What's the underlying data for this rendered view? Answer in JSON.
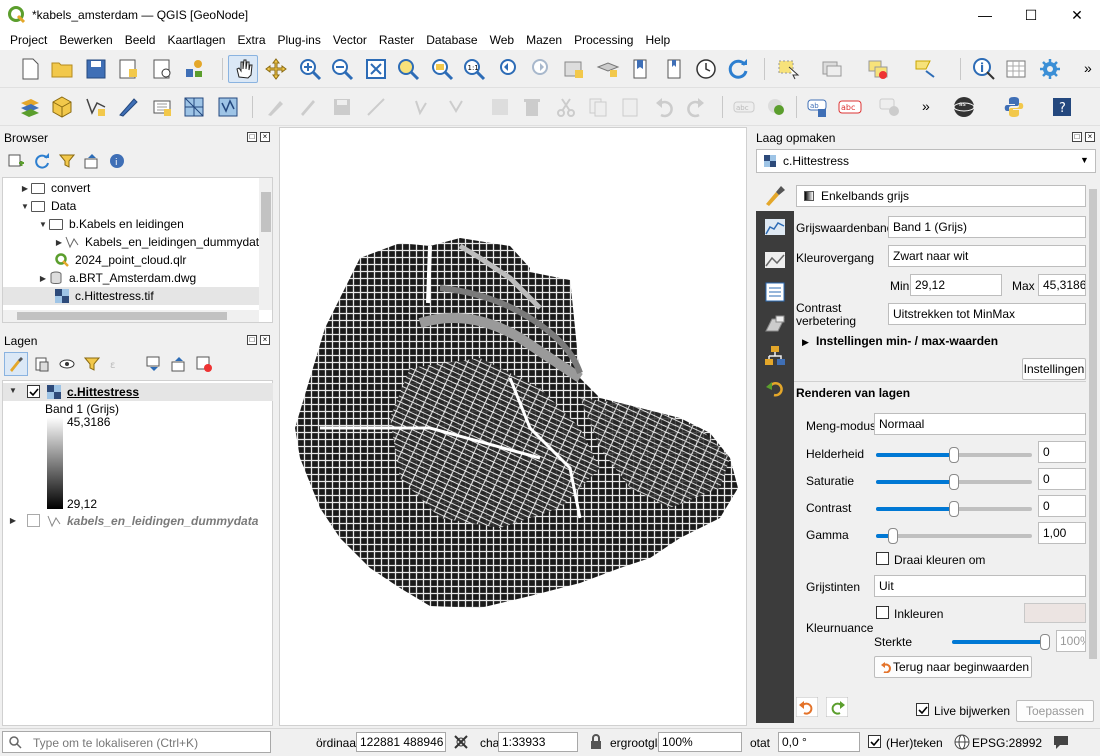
{
  "window": {
    "title": "*kabels_amsterdam — QGIS [GeoNode]"
  },
  "menu": [
    "Project",
    "Bewerken",
    "Beeld",
    "Kaartlagen",
    "Extra",
    "Plug-ins",
    "Vector",
    "Raster",
    "Database",
    "Web",
    "Mazen",
    "Processing",
    "Help"
  ],
  "toolbar_icons_row1": [
    "new-project-icon",
    "open-project-icon",
    "save-project-icon",
    "new-print-layout-icon",
    "layout-manager-icon",
    "style-manager-icon",
    "pan-icon",
    "pan-to-selection-icon",
    "zoom-in-icon",
    "zoom-out-icon",
    "zoom-full-icon",
    "zoom-to-selection-icon",
    "zoom-to-layer-icon",
    "zoom-native-icon",
    "zoom-last-icon",
    "zoom-next-icon",
    "new-bookmark-icon",
    "show-bookmarks-icon",
    "temporal-controller-icon",
    "refresh-icon",
    "select-features-icon",
    "deselect-icon",
    "select-by-expression-icon",
    "identify-icon",
    "attribute-table-icon",
    "settings-icon"
  ],
  "toolbar_icons_row2": [
    "data-source-manager-icon",
    "new-geopackage-icon",
    "new-shapefile-icon",
    "digitize-icon",
    "virtual-layer-icon",
    "new-mesh-icon",
    "toggle-editing-icon",
    "save-edits-icon",
    "add-feature-icon",
    "vertex-tool-icon",
    "delete-icon",
    "cut-icon",
    "copy-icon",
    "paste-icon",
    "undo-icon",
    "redo-icon",
    "label-icon",
    "pin-labels-icon",
    "show-labels-icon",
    "python-icon",
    "help-icon"
  ],
  "browser": {
    "title": "Browser",
    "items": [
      {
        "label": "convert",
        "type": "folder"
      },
      {
        "label": "Data",
        "type": "folder"
      },
      {
        "label": "b.Kabels en leidingen",
        "type": "folder"
      },
      {
        "label": "Kabels_en_leidingen_dummydata.s",
        "type": "vector"
      },
      {
        "label": "2024_point_cloud.qlr",
        "type": "qgis"
      },
      {
        "label": "a.BRT_Amsterdam.dwg",
        "type": "db"
      },
      {
        "label": "c.Hittestress.tif",
        "type": "raster"
      }
    ]
  },
  "layers": {
    "title": "Lagen",
    "layer1": {
      "name": "c.Hittestress",
      "band": "Band 1 (Grijs)",
      "max": "45,3186",
      "min": "29,12"
    },
    "layer2": {
      "name": "kabels_en_leidingen_dummydata"
    }
  },
  "styling": {
    "title": "Laag opmaken",
    "layer_select": "c.Hittestress",
    "renderer": "Enkelbands grijs",
    "band_label": "Grijswaardenband",
    "band_value": "Band 1 (Grijs)",
    "gradient_label": "Kleurovergang",
    "gradient_value": "Zwart naar wit",
    "min_label": "Min",
    "min_value": "29,12",
    "max_label": "Max",
    "max_value": "45,3186",
    "contrast_label": "Contrast verbetering",
    "contrast_value": "Uitstrekken tot MinMax",
    "minmax_section": "Instellingen min- / max-waarden",
    "settings_button": "Instellingen",
    "render_section": "Renderen van lagen",
    "blend_label": "Meng-modus",
    "blend_value": "Normaal",
    "brightness_label": "Helderheid",
    "brightness_value": "0",
    "saturation_label": "Saturatie",
    "saturation_value": "0",
    "contrast2_label": "Contrast",
    "contrast2_value": "0",
    "gamma_label": "Gamma",
    "gamma_value": "1,00",
    "invert_label": "Draai kleuren om",
    "grayscale_label": "Grijstinten",
    "grayscale_value": "Uit",
    "colorize_label": "Inkleuren",
    "hue_label": "Kleurnuance",
    "strength_label": "Sterkte",
    "strength_value": "100%",
    "reset_button": "Terug naar beginwaarden",
    "live_update_label": "Live bijwerken",
    "apply_button": "Toepassen"
  },
  "status": {
    "search_placeholder": "Type om te lokaliseren (Ctrl+K)",
    "coord_label": "ördinaa",
    "coord_value": "122881  488946",
    "scale_label": "cha",
    "scale_value": "1:33933",
    "magnifier_label": "ergrootgla",
    "magnifier_value": "100%",
    "rotation_label": "otat",
    "rotation_value": "0,0 °",
    "render_label": "(Her)teken",
    "crs": "EPSG:28992"
  }
}
